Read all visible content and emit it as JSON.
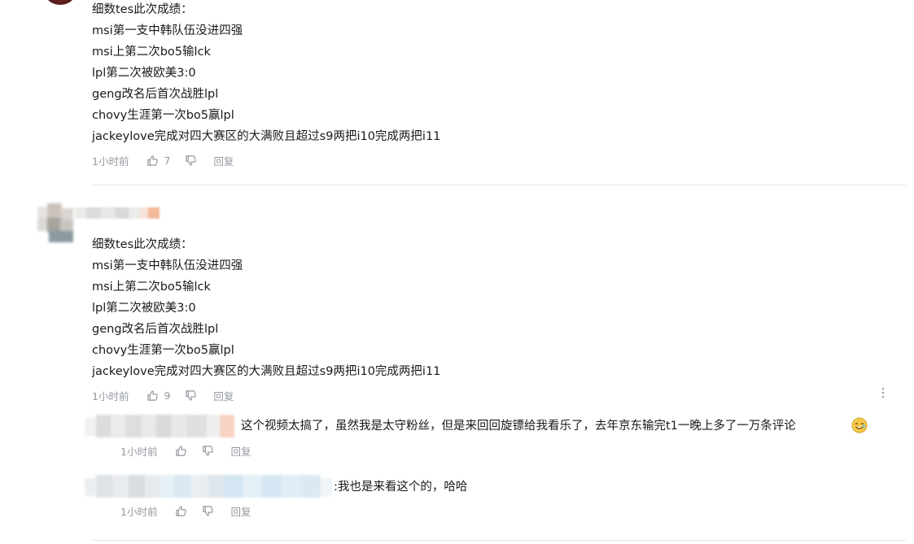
{
  "comments": [
    {
      "lines": [
        "细数tes此次成绩：",
        "msi第一支中韩队伍没进四强",
        "msi上第二次bo5输lck",
        "lpl第二次被欧美3:0",
        "geng改名后首次战胜lpl",
        "chovy生涯第一次bo5赢lpl",
        "jackeylove完成对四大赛区的大满败且超过s9两把i10完成两把i11"
      ],
      "time": "1小时前",
      "likes": "7",
      "reply_label": "回复"
    },
    {
      "lines": [
        "细数tes此次成绩：",
        "msi第一支中韩队伍没进四强",
        "msi上第二次bo5输lck",
        "lpl第二次被欧美3:0",
        "geng改名后首次战胜lpl",
        "chovy生涯第一次bo5赢lpl",
        "jackeylove完成对四大赛区的大满败且超过s9两把i10完成两把i11"
      ],
      "time": "1小时前",
      "likes": "9",
      "reply_label": "回复"
    }
  ],
  "replies": [
    {
      "text": "这个视频太搞了，虽然我是太守粉丝，但是来回回旋镖给我看乐了，去年京东输完t1一晚上多了一万条评论",
      "time": "1小时前",
      "reply_label": "回复"
    },
    {
      "text": ":我也是来看这个的，哈哈",
      "time": "1小时前",
      "reply_label": "回复"
    }
  ],
  "icons": {
    "like": "thumbs-up-icon",
    "dislike": "thumbs-down-icon",
    "more": "more-vertical-icon"
  },
  "colors": {
    "text": "#18191c",
    "meta": "#9499a0",
    "divider": "#e3e5e7"
  }
}
